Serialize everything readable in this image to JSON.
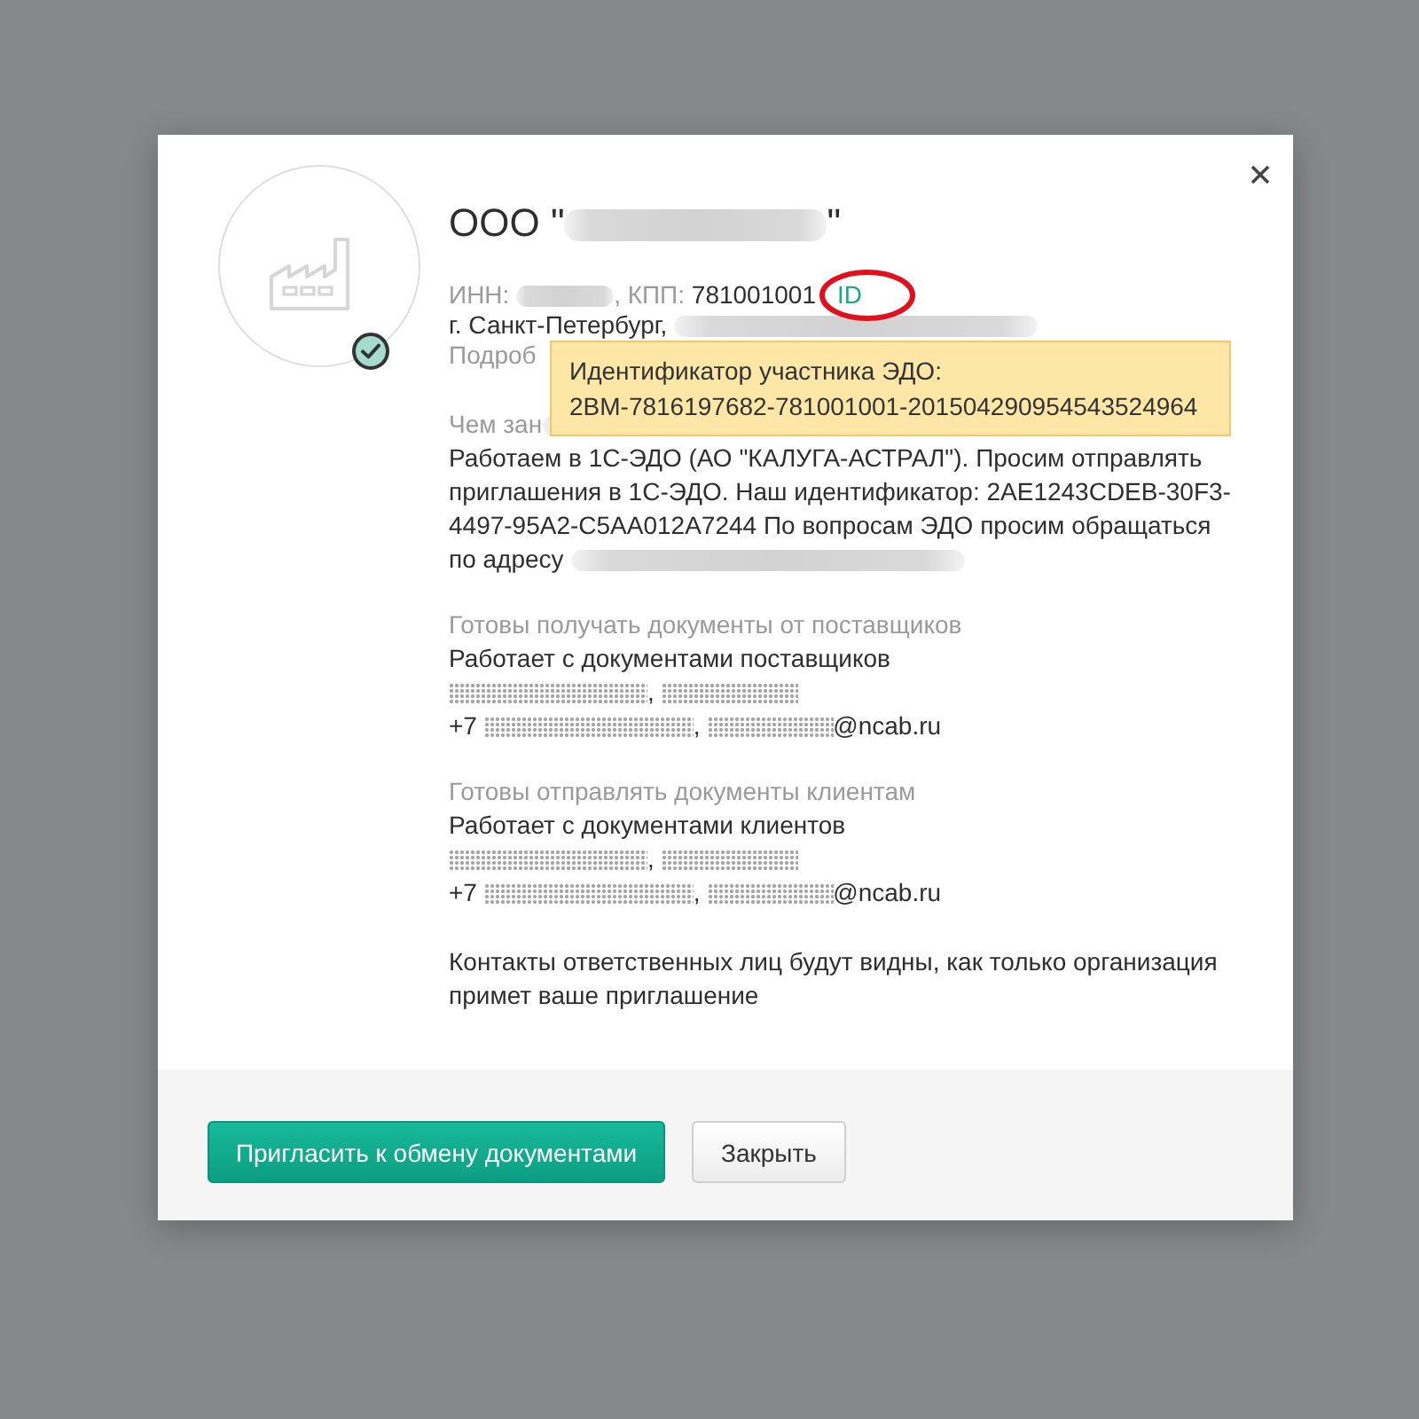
{
  "company": {
    "name": [
      {
        "kind": "value",
        "text": "ООО \""
      },
      {
        "kind": "blurred"
      },
      {
        "kind": "value",
        "text": "\""
      }
    ],
    "verified": true,
    "requisites": [
      {
        "kind": "label",
        "text": "ИНН: "
      },
      {
        "kind": "blurred"
      },
      {
        "kind": "label",
        "text": ", КПП: "
      },
      {
        "kind": "value",
        "text": "781001001"
      },
      {
        "kind": "link",
        "text": "ID",
        "highlighted": true
      }
    ],
    "address": [
      {
        "kind": "value",
        "text": "г. Санкт-Петербург, "
      },
      {
        "kind": "blurred"
      }
    ],
    "more_link": "Подроб",
    "id_tooltip": {
      "title": "Идентификатор участника ЭДО:",
      "value": "2BM-7816197682-781001001-201504290954543524964"
    }
  },
  "sections": [
    {
      "heading": [
        {
          "kind": "label",
          "text": "Чем зан"
        },
        {
          "kind": "blurred"
        }
      ],
      "lines": [
        [
          {
            "kind": "value",
            "text": "Работаем в 1С-ЭДО (АО \"КАЛУГА-АСТРАЛ\"). Просим отправлять приглашения в 1С-ЭДО. Наш идентификатор: 2AE1243CDEB-30F3-4497-95A2-C5AA012A7244 По вопросам ЭДО просим обращаться"
          }
        ],
        [
          {
            "kind": "value",
            "text": "по адресу "
          },
          {
            "kind": "blurred"
          }
        ]
      ]
    },
    {
      "heading": [
        {
          "kind": "label",
          "text": "Готовы получать документы от поставщиков"
        }
      ],
      "lines": [
        [
          {
            "kind": "value",
            "text": "Работает с документами поставщиков"
          }
        ],
        [
          {
            "kind": "pixelated"
          },
          {
            "kind": "value",
            "text": ", "
          },
          {
            "kind": "pixelated"
          }
        ],
        [
          {
            "kind": "value",
            "text": "+7 "
          },
          {
            "kind": "pixelated"
          },
          {
            "kind": "value",
            "text": ", "
          },
          {
            "kind": "pixelated"
          },
          {
            "kind": "value",
            "text": "@ncab.ru"
          }
        ]
      ]
    },
    {
      "heading": [
        {
          "kind": "label",
          "text": "Готовы отправлять документы клиентам"
        }
      ],
      "lines": [
        [
          {
            "kind": "value",
            "text": "Работает с документами клиентов"
          }
        ],
        [
          {
            "kind": "pixelated"
          },
          {
            "kind": "value",
            "text": ", "
          },
          {
            "kind": "pixelated"
          }
        ],
        [
          {
            "kind": "value",
            "text": "+7 "
          },
          {
            "kind": "pixelated"
          },
          {
            "kind": "value",
            "text": ", "
          },
          {
            "kind": "pixelated"
          },
          {
            "kind": "value",
            "text": "@ncab.ru"
          }
        ]
      ]
    }
  ],
  "notice": "Контакты ответственных лиц будут видны, как только организация примет ваше приглашение",
  "buttons": [
    {
      "label": "Пригласить к обмену документами",
      "kind": "primary"
    },
    {
      "label": "Закрыть",
      "kind": "secondary"
    }
  ]
}
